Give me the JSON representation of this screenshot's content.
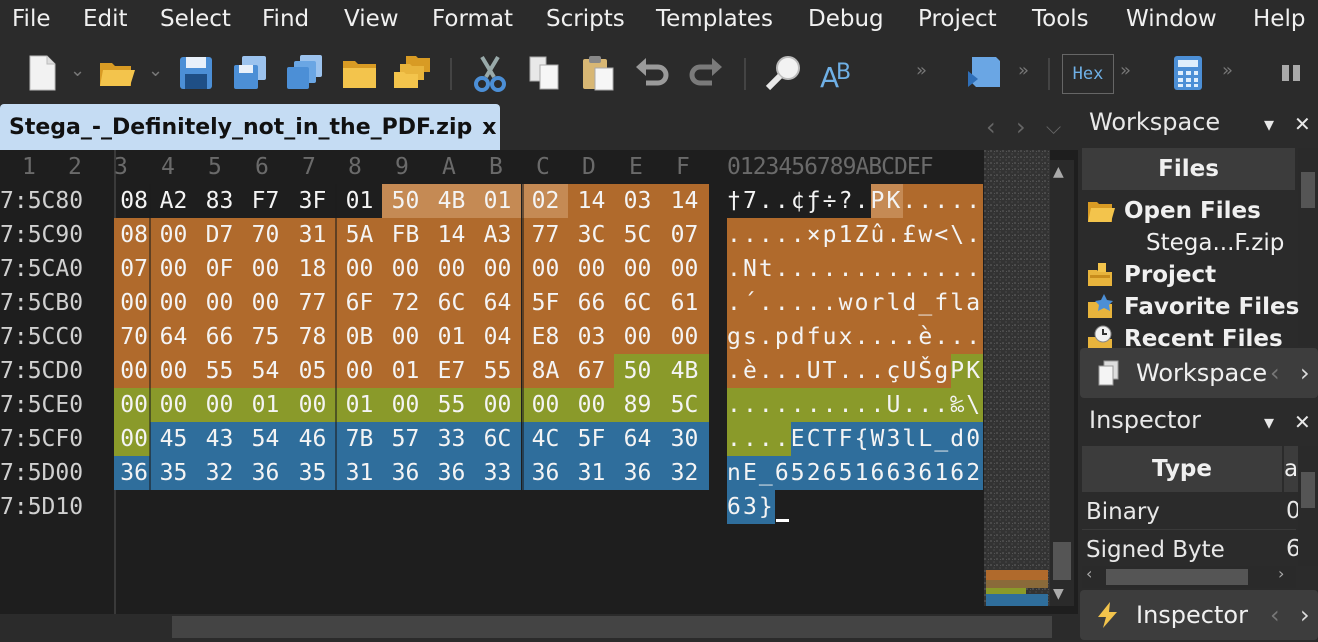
{
  "menu": [
    "File",
    "Edit",
    "Select",
    "Find",
    "View",
    "Format",
    "Scripts",
    "Templates",
    "Debug",
    "Project",
    "Tools",
    "Window",
    "Help"
  ],
  "toolbar": {
    "icons": [
      "new-file-icon",
      "open-folder-icon",
      "save-icon",
      "save-as-icon",
      "save-all-icon",
      "open-folder-2-icon",
      "open-workspace-icon",
      "cut-icon",
      "copy-icon",
      "paste-icon",
      "undo-icon",
      "redo-icon",
      "find-icon",
      "replace-icon",
      "script-run-icon",
      "hex-icon",
      "calculator-icon",
      "pause-icon"
    ],
    "hex_label": "Hex",
    "overflow": "»"
  },
  "tab": {
    "title": "Stega_-_Definitely_not_in_the_PDF.zip",
    "close": "x"
  },
  "editor": {
    "col_headers": [
      "1",
      "2",
      "3",
      "4",
      "5",
      "6",
      "7",
      "8",
      "9",
      "A",
      "B",
      "C",
      "D",
      "E",
      "F"
    ],
    "text_header": "0123456789ABCDEF",
    "addresses": [
      "7:5C80",
      "7:5C90",
      "7:5CA0",
      "7:5CB0",
      "7:5CC0",
      "7:5CD0",
      "7:5CE0",
      "7:5CF0",
      "7:5D00",
      "7:5D10"
    ],
    "rows": [
      [
        "08",
        "A2",
        "83",
        "F7",
        "3F",
        "01",
        "50",
        "4B",
        "01",
        "02",
        "14",
        "03",
        "14"
      ],
      [
        "08",
        "00",
        "D7",
        "70",
        "31",
        "5A",
        "FB",
        "14",
        "A3",
        "77",
        "3C",
        "5C",
        "07"
      ],
      [
        "07",
        "00",
        "0F",
        "00",
        "18",
        "00",
        "00",
        "00",
        "00",
        "00",
        "00",
        "00",
        "00"
      ],
      [
        "00",
        "00",
        "00",
        "00",
        "77",
        "6F",
        "72",
        "6C",
        "64",
        "5F",
        "66",
        "6C",
        "61"
      ],
      [
        "70",
        "64",
        "66",
        "75",
        "78",
        "0B",
        "00",
        "01",
        "04",
        "E8",
        "03",
        "00",
        "00"
      ],
      [
        "00",
        "00",
        "55",
        "54",
        "05",
        "00",
        "01",
        "E7",
        "55",
        "8A",
        "67",
        "50",
        "4B"
      ],
      [
        "00",
        "00",
        "00",
        "01",
        "00",
        "01",
        "00",
        "55",
        "00",
        "00",
        "00",
        "89",
        "5C"
      ],
      [
        "00",
        "45",
        "43",
        "54",
        "46",
        "7B",
        "57",
        "33",
        "6C",
        "4C",
        "5F",
        "64",
        "30"
      ],
      [
        "36",
        "35",
        "32",
        "36",
        "35",
        "31",
        "36",
        "36",
        "33",
        "36",
        "31",
        "36",
        "32"
      ]
    ],
    "text_rows": [
      "†7..¢ƒ÷?.PK.....",
      ".....×p1Zû.£w<\\.",
      ".Nt.............",
      ".´.....world_fla",
      "gs.pdfux....è...",
      ".è...UT...çUŠgPK",
      "..........U...‰\\",
      "....ECTF{W3lL_d0",
      "nE_6526516636162",
      "63}"
    ]
  },
  "colors": {
    "orange": "#b06a2c",
    "orange_light": "#c58a54",
    "olive": "#8a9a2a",
    "blue": "#2f6e9c",
    "tab_bg": "#c5dcf3"
  },
  "workspace": {
    "title": "Workspace",
    "files_header": "Files",
    "items": [
      "Open Files",
      "Stega...F.zip",
      "Project",
      "Favorite Files",
      "Recent Files"
    ],
    "dock_label": "Workspace"
  },
  "inspector": {
    "title": "Inspector",
    "type_header": "Type",
    "value_header_partial": "a",
    "rows": [
      {
        "type": "Binary",
        "value": "0"
      },
      {
        "type": "Signed Byte",
        "value": "6"
      }
    ],
    "dock_label": "Inspector"
  },
  "panel_controls": {
    "dropdown": "▾",
    "close": "✕"
  }
}
